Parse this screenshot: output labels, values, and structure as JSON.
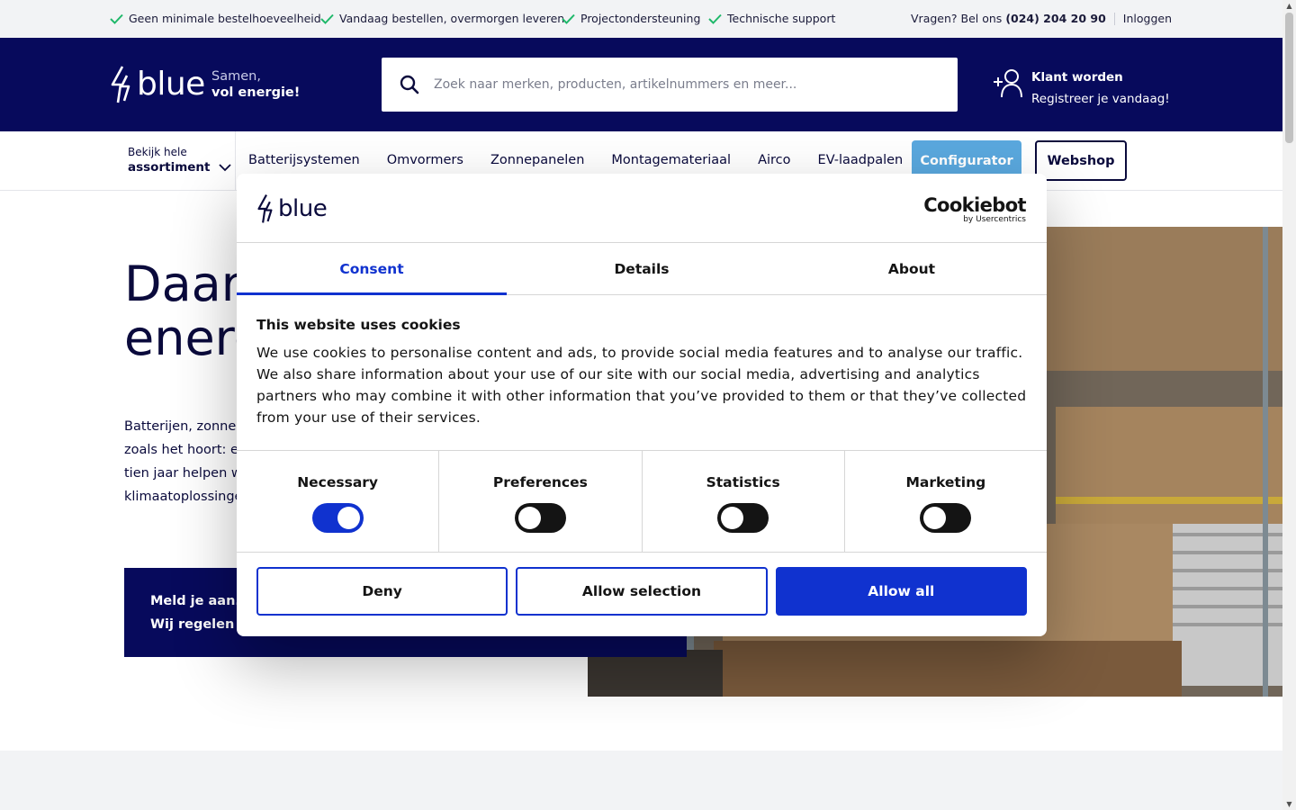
{
  "topbar": {
    "usps": [
      "Geen minimale bestelhoeveelheid",
      "Vandaag bestellen, overmorgen leveren",
      "Projectondersteuning",
      "Technische support"
    ],
    "call_label": "Vragen? Bel ons",
    "phone": "(024) 204 20 90",
    "login": "Inloggen"
  },
  "header": {
    "logo_text": "blue",
    "tagline_1": "Samen,",
    "tagline_2": "vol energie!",
    "search_placeholder": "Zoek naar merken, producten, artikelnummers en meer...",
    "account_title": "Klant worden",
    "account_sub": "Registreer je vandaag!"
  },
  "nav": {
    "assort_1": "Bekijk hele",
    "assort_2": "assortiment",
    "links": [
      "Batterijsystemen",
      "Omvormers",
      "Zonnepanelen",
      "Montagemateriaal",
      "Airco",
      "EV-laadpalen"
    ],
    "configurator": "Configurator",
    "webshop": "Webshop"
  },
  "hero": {
    "title_1": "Daar",
    "title_2": "energ",
    "text_1": "Batterijen, zonnep",
    "text_2": "zoals het hoort: ee",
    "text_3": "tien jaar helpen w",
    "text_4": "klimaatoplossinge",
    "cta_1": "Meld je aan.",
    "cta_2": "Wij regelen d"
  },
  "cookie": {
    "brand_logo_text": "blue",
    "cookiebot": "Cookiebot",
    "cookiebot_sub": "by Usercentrics",
    "tabs": [
      "Consent",
      "Details",
      "About"
    ],
    "heading": "This website uses cookies",
    "body": "We use cookies to personalise content and ads, to provide social media features and to analyse our traffic. We also share information about your use of our site with our social media, advertising and analytics partners who may combine it with other information that you’ve provided to them or that they’ve collected from your use of their services.",
    "categories": [
      {
        "label": "Necessary",
        "on": true
      },
      {
        "label": "Preferences",
        "on": false
      },
      {
        "label": "Statistics",
        "on": false
      },
      {
        "label": "Marketing",
        "on": false
      }
    ],
    "deny": "Deny",
    "allow_selection": "Allow selection",
    "allow_all": "Allow all"
  },
  "colors": {
    "navy": "#070a5c",
    "cookie_blue": "#1032cf",
    "configurator": "#5aa8de",
    "check_green": "#1fb86a"
  }
}
